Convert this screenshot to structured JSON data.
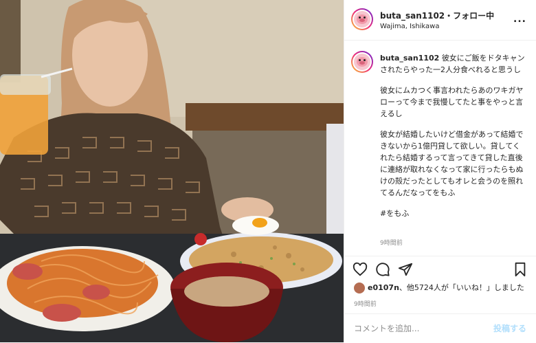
{
  "post": {
    "username": "buta_san1102",
    "follow_text": "・フォロー中",
    "location": "Wajima, Ishikawa",
    "more": "...",
    "caption_paragraphs": [
      "彼女にご飯をドタキャンされたらやった一2人分食べれると思うし",
      "彼女にムカつく事言われたらあのワキガヤローって今まで我慢してたと事をやっと言えるし",
      "彼女が結婚したいけど借金があって結婚できないから1億円貸して欲しい。貸してくれたら結婚するって言ってきて貸した直後に連絡が取れなくなって家に行ったらもぬけの殻だったとしてもオレと会うのを照れてるんだなってをもふ",
      "#をもふ"
    ],
    "caption_time": "9時間前",
    "liked_by_user": "e0107n",
    "likes_rest": "、他5724人が「いいね！」しました",
    "time_ago": "9時間前",
    "comment_placeholder": "コメントを追加...",
    "post_button": "投稿する"
  },
  "colors": {
    "link_disabled": "#b2dffc",
    "text": "#262626",
    "muted": "#8e8e8e"
  },
  "icons": [
    "heart-icon",
    "comment-icon",
    "share-icon",
    "bookmark-icon",
    "more-icon"
  ]
}
